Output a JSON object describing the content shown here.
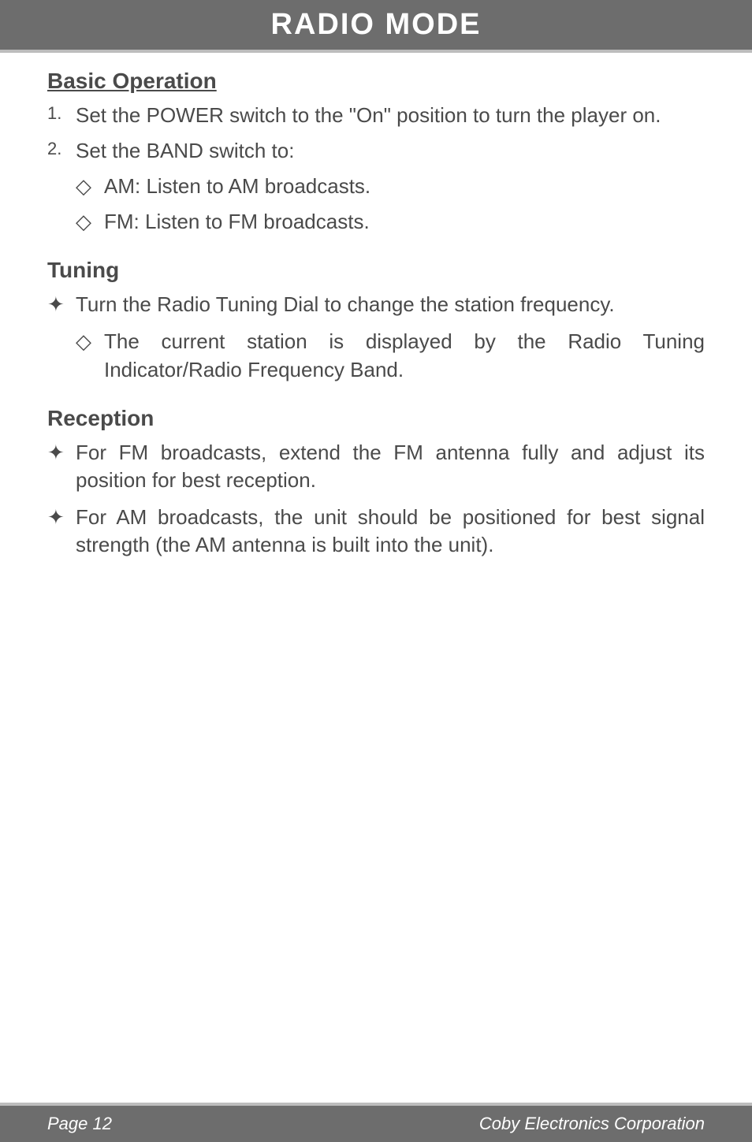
{
  "header": {
    "title": "RADIO MODE"
  },
  "section": {
    "title": "Basic Operation",
    "items": [
      {
        "num": "1.",
        "text": "Set the POWER switch to the \"On\" position to turn the player on."
      },
      {
        "num": "2.",
        "text": "Set the BAND switch to:"
      }
    ],
    "sub_items": [
      {
        "bullet": "◇",
        "text": "AM: Listen to AM broadcasts."
      },
      {
        "bullet": "◇",
        "text": "FM: Listen to FM broadcasts."
      }
    ]
  },
  "tuning": {
    "title": "Tuning",
    "items": [
      {
        "bullet": "✦",
        "text": "Turn the Radio Tuning Dial to change the station frequency."
      }
    ],
    "sub_items": [
      {
        "bullet": "◇",
        "text": "The current station is displayed by the Radio Tuning Indicator/Radio Frequency Band."
      }
    ]
  },
  "reception": {
    "title": "Reception",
    "items": [
      {
        "bullet": "✦",
        "text": "For FM broadcasts, extend the FM antenna fully and adjust its position for best reception."
      },
      {
        "bullet": "✦",
        "text": "For AM broadcasts, the unit should be positioned for best signal strength (the AM antenna is built into the unit)."
      }
    ]
  },
  "footer": {
    "page": "Page 12",
    "company": "Coby Electronics Corporation"
  }
}
